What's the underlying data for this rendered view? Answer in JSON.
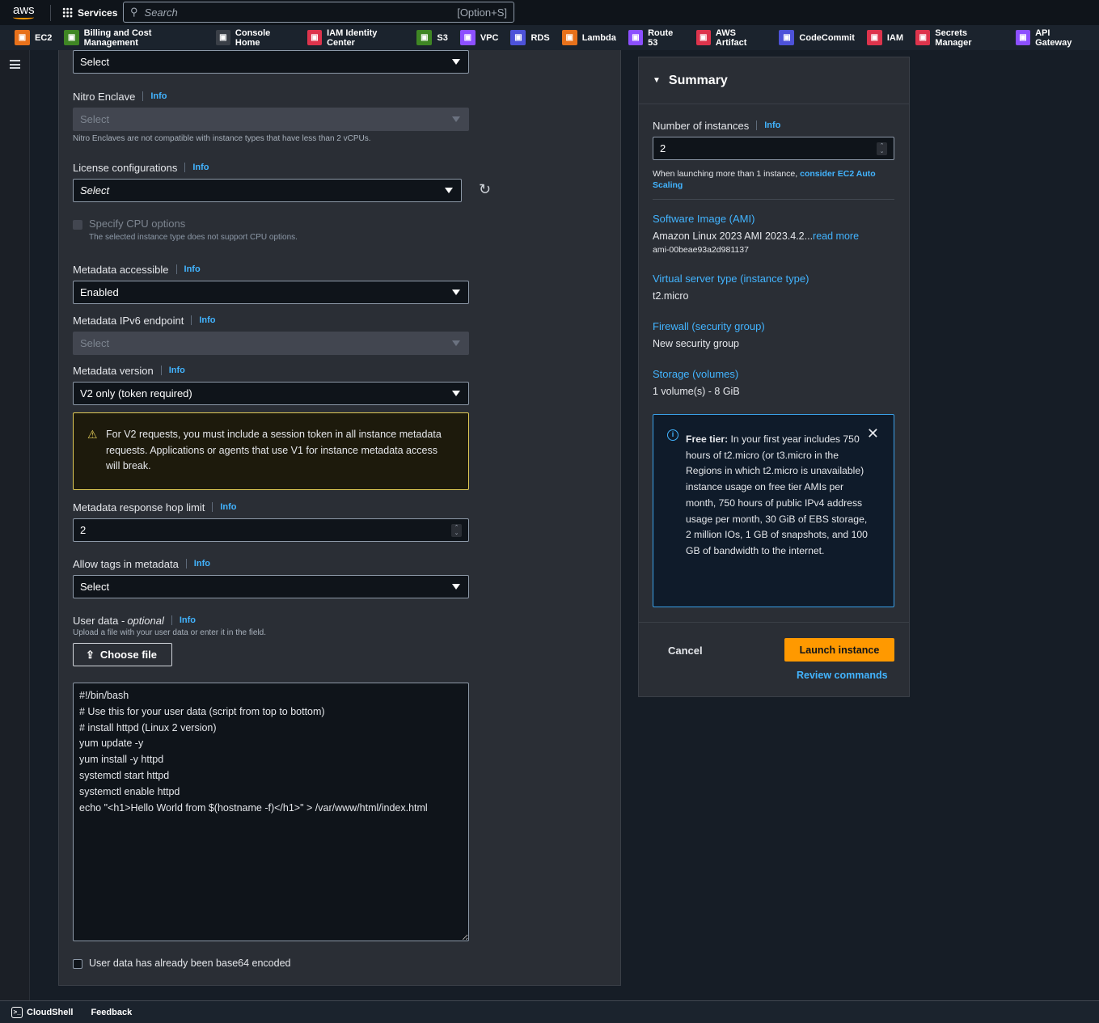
{
  "topbar": {
    "logo": "aws",
    "services": "Services",
    "search_placeholder": "Search",
    "search_shortcut": "[Option+S]"
  },
  "favorites": [
    {
      "label": "EC2",
      "color": "#e7711b",
      "icon": "ec2-icon"
    },
    {
      "label": "Billing and Cost Management",
      "color": "#3f8624",
      "icon": "billing-icon"
    },
    {
      "label": "Console Home",
      "color": "#3a3f47",
      "icon": "cube-icon"
    },
    {
      "label": "IAM Identity Center",
      "color": "#dd344c",
      "icon": "identity-center-icon"
    },
    {
      "label": "S3",
      "color": "#3f8624",
      "icon": "bucket-icon"
    },
    {
      "label": "VPC",
      "color": "#8c4fff",
      "icon": "vpc-icon"
    },
    {
      "label": "RDS",
      "color": "#4d52d9",
      "icon": "rds-icon"
    },
    {
      "label": "Lambda",
      "color": "#e7711b",
      "icon": "lambda-icon"
    },
    {
      "label": "Route 53",
      "color": "#8c4fff",
      "icon": "route53-icon"
    },
    {
      "label": "AWS Artifact",
      "color": "#dd344c",
      "icon": "artifact-icon"
    },
    {
      "label": "CodeCommit",
      "color": "#4d52d9",
      "icon": "codecommit-icon"
    },
    {
      "label": "IAM",
      "color": "#dd344c",
      "icon": "iam-icon"
    },
    {
      "label": "Secrets Manager",
      "color": "#dd344c",
      "icon": "secrets-icon"
    },
    {
      "label": "API Gateway",
      "color": "#8c4fff",
      "icon": "api-gateway-icon"
    }
  ],
  "form": {
    "top_select": "Select",
    "nitro": {
      "label": "Nitro Enclave",
      "info": "Info",
      "value": "Select",
      "hint": "Nitro Enclaves are not compatible with instance types that have less than 2 vCPUs."
    },
    "license": {
      "label": "License configurations",
      "info": "Info",
      "value": "Select"
    },
    "cpu": {
      "label": "Specify CPU options",
      "hint": "The selected instance type does not support CPU options."
    },
    "meta_access": {
      "label": "Metadata accessible",
      "info": "Info",
      "value": "Enabled"
    },
    "meta_ipv6": {
      "label": "Metadata IPv6 endpoint",
      "info": "Info",
      "value": "Select"
    },
    "meta_version": {
      "label": "Metadata version",
      "info": "Info",
      "value": "V2 only (token required)"
    },
    "warning": "For V2 requests, you must include a session token in all instance metadata requests. Applications or agents that use V1 for instance metadata access will break.",
    "hop": {
      "label": "Metadata response hop limit",
      "info": "Info",
      "value": "2"
    },
    "tags": {
      "label": "Allow tags in metadata",
      "info": "Info",
      "value": "Select"
    },
    "user_data": {
      "label": "User data - ",
      "optional": "optional",
      "info": "Info",
      "hint": "Upload a file with your user data or enter it in the field.",
      "choose": "Choose file",
      "value": "#!/bin/bash\n# Use this for your user data (script from top to bottom)\n# install httpd (Linux 2 version)\nyum update -y\nyum install -y httpd\nsystemctl start httpd\nsystemctl enable httpd\necho \"<h1>Hello World from $(hostname -f)</h1>\" > /var/www/html/index.html"
    },
    "base64": "User data has already been base64 encoded"
  },
  "summary": {
    "title": "Summary",
    "instances_label": "Number of instances",
    "info": "Info",
    "instances": "2",
    "scaling_text": "When launching more than 1 instance, ",
    "scaling_link": "consider EC2 Auto Scaling",
    "ami_title": "Software Image (AMI)",
    "ami_value": "Amazon Linux 2023 AMI 2023.4.2...",
    "read_more": "read more",
    "ami_id": "ami-00beae93a2d981137",
    "type_title": "Virtual server type (instance type)",
    "type_value": "t2.micro",
    "fw_title": "Firewall (security group)",
    "fw_value": "New security group",
    "storage_title": "Storage (volumes)",
    "storage_value": "1 volume(s) - 8 GiB",
    "free_bold": "Free tier:",
    "free_text": " In your first year includes 750 hours of t2.micro (or t3.micro in the Regions in which t2.micro is unavailable) instance usage on free tier AMIs per month, 750 hours of public IPv4 address usage per month, 30 GiB of EBS storage, 2 million IOs, 1 GB of snapshots, and 100 GB of bandwidth to the internet.",
    "cancel": "Cancel",
    "launch": "Launch instance",
    "review": "Review commands"
  },
  "bottom": {
    "cloudshell": "CloudShell",
    "feedback": "Feedback"
  }
}
